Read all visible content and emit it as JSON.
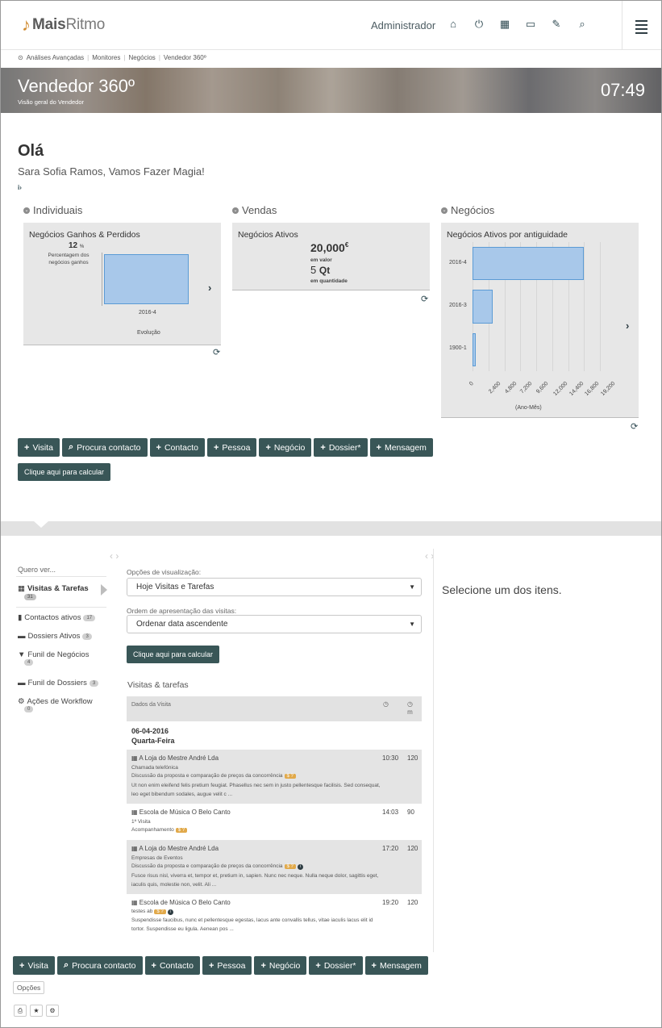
{
  "header": {
    "brand_prefix": "Mais",
    "brand_suffix": "Ritmo",
    "user": "Administrador",
    "icons": [
      "home-icon",
      "power-icon",
      "grid-icon",
      "calendar-icon",
      "wrench-icon",
      "search-icon",
      "menu-icon"
    ]
  },
  "breadcrumb": [
    "Análises Avançadas",
    "Monitores",
    "Negócios",
    "Vendedor 360º"
  ],
  "banner": {
    "title": "Vendedor 360º",
    "subtitle": "Visão geral do Vendedor",
    "clock": "07:49"
  },
  "greeting": {
    "hello": "Olá",
    "message": "Sara Sofia Ramos, Vamos Fazer Magia!",
    "tiny": "i›"
  },
  "sections": {
    "individuais": {
      "label": "Individuais",
      "panel_title": "Negócios Ganhos & Perdidos",
      "percent": "12",
      "percent_unit": "%",
      "percent_caption_1": "Percentagem dos",
      "percent_caption_2": "negócios ganhos",
      "x_label": "2016-4",
      "caption": "Evolução"
    },
    "vendas": {
      "label": "Vendas",
      "panel_title": "Negócios Ativos",
      "value": "20,000",
      "value_unit": "€",
      "value_caption": "em valor",
      "qty": "5",
      "qty_unit": "Qt",
      "qty_caption": "em quantidade"
    },
    "negocios": {
      "label": "Negócios",
      "panel_title": "Negócios Ativos por antiguidade",
      "caption": "(Ano-Mês)"
    }
  },
  "chart_data": [
    {
      "type": "bar",
      "categories": [
        "2016-4"
      ],
      "values": [
        12
      ],
      "xlabel": "Evolução"
    },
    {
      "type": "bar",
      "orientation": "horizontal",
      "categories": [
        "2016-4",
        "2016-3",
        "1900-1"
      ],
      "values": [
        16800,
        3000,
        500
      ],
      "x_ticks": [
        "0",
        "2,400",
        "4,800",
        "7,200",
        "9,600",
        "12,000",
        "14,400",
        "16,800",
        "19,200"
      ],
      "xlabel": "(Ano-Mês)",
      "xlim": [
        0,
        19200
      ]
    }
  ],
  "actions": [
    {
      "icon": "+",
      "label": "Visita"
    },
    {
      "icon": "⌕",
      "label": "Procura contacto"
    },
    {
      "icon": "+",
      "label": "Contacto"
    },
    {
      "icon": "+",
      "label": "Pessoa"
    },
    {
      "icon": "+",
      "label": "Negócio"
    },
    {
      "icon": "+",
      "label": "Dossier*"
    },
    {
      "icon": "+",
      "label": "Mensagem"
    }
  ],
  "calc_label": "Clique aqui para calcular",
  "lower": {
    "want_to_see": "Quero ver...",
    "nav": [
      {
        "label": "Visitas & Tarefas",
        "badge": "31"
      },
      {
        "label": "Contactos ativos",
        "badge": "17"
      },
      {
        "label": "Dossiers Ativos",
        "badge": "3"
      },
      {
        "label": "Funil de Negócios",
        "badge": "4"
      },
      {
        "label": "Funil de Dossiers",
        "badge": "3"
      },
      {
        "label": "Ações de Workflow",
        "badge": "0"
      }
    ],
    "view_options_label": "Opções de visualização:",
    "view_options_value": "Hoje Visitas e Tarefas",
    "order_label": "Ordem de apresentação das visitas:",
    "order_value": "Ordenar data ascendente",
    "calc_label": "Clique aqui para calcular",
    "table_title": "Visitas & tarefas",
    "table_header": "Dados da Visita",
    "col_min_unit": "m",
    "date": "06-04-2016",
    "weekday": "Quarta-Feira",
    "visits": [
      {
        "title": "A Loja do Mestre André Lda",
        "time": "10:30",
        "minutes": "120",
        "type": "Chamada telefónica",
        "desc": "Discussão da proposta e comparação de preços da concorrência",
        "tag": "$ ?",
        "note1": "Ut non enim eleifend felis pretium feugiat. Phasellus nec sem in justo pellentesque facilisis. Sed consequat,",
        "note2": "leo eget bibendum sodales, augue velit c ..."
      },
      {
        "title": "Escola de Música O Belo Canto",
        "time": "14:03",
        "minutes": "90",
        "type": "1ª Visita",
        "desc": "Acompanhamento",
        "tag": "$ ?"
      },
      {
        "title": "A Loja do Mestre André Lda",
        "time": "17:20",
        "minutes": "120",
        "type": "Empresas de Eventos",
        "desc": "Discussão da proposta e comparação de preços da concorrência",
        "tag": "$ ?",
        "note1": "Fusce risus nisl, viverra et, tempor et, pretium in, sapien. Nunc nec neque. Nulla neque dolor, sagittis eget,",
        "note2": "iaculis quis, molestie non, velit. Ali ..."
      },
      {
        "title": "Escola de Música O Belo Canto",
        "time": "19:20",
        "minutes": "120",
        "type": "testes ab",
        "tag": "$ ?",
        "note1": "Suspendisse faucibus, nunc et pellentesque egestas, lacus ante convallis tellus, vitae iaculis lacus elit id",
        "note2": "tortor. Suspendisse eu ligula. Aenean pos ..."
      }
    ],
    "select_one": "Selecione um dos itens.",
    "options": "Opções"
  }
}
